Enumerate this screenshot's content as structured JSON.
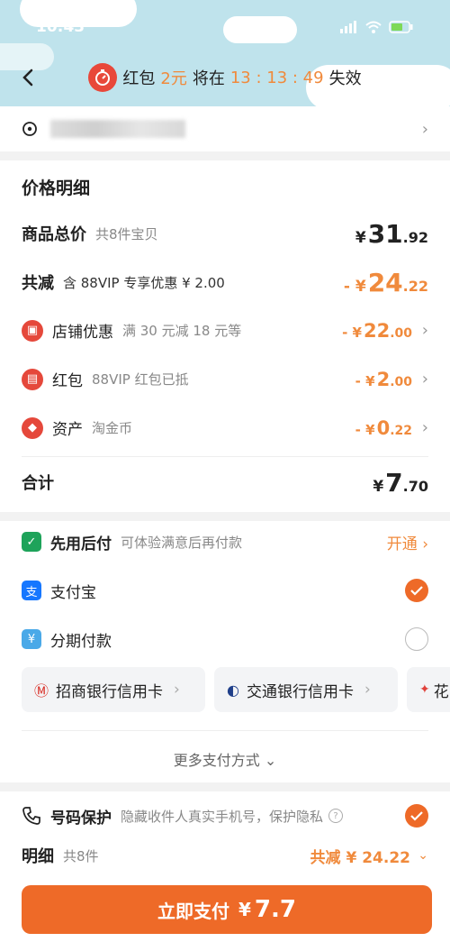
{
  "status_bar": {
    "time": "10:43"
  },
  "header": {
    "back_icon": "chevron-left-icon",
    "redpacket_label": "红包",
    "redpacket_amount": "2元",
    "expire_prefix": "将在",
    "countdown": "13 : 13 : 49",
    "expire_suffix": "失效"
  },
  "address": {
    "icon": "location-pin-icon"
  },
  "price_detail": {
    "heading": "价格明细",
    "total_label": "商品总价",
    "total_note": "共8件宝贝",
    "total_yen": "¥",
    "total_int": "31",
    "total_dec": ".92",
    "reduce_label": "共减",
    "reduce_note": "含 88VIP 专享优惠 ¥ 2.00",
    "reduce_prefix": "- ¥",
    "reduce_int": "24",
    "reduce_dec": ".22",
    "items": [
      {
        "icon": "shop-icon",
        "label": "店铺优惠",
        "note": "满 30 元减 18 元等",
        "prefix": "- ¥",
        "int": "22",
        "dec": ".00"
      },
      {
        "icon": "red-packet-icon",
        "label": "红包",
        "note": "88VIP 红包已抵",
        "prefix": "- ¥",
        "int": "2",
        "dec": ".00"
      },
      {
        "icon": "coin-tag-icon",
        "label": "资产",
        "note": "淘金币",
        "prefix": "- ¥",
        "int": "0",
        "dec": ".22"
      }
    ],
    "sum_label": "合计",
    "sum_yen": "¥",
    "sum_int": "7",
    "sum_dec": ".70"
  },
  "payment": {
    "later_label": "先用后付",
    "later_note": "可体验满意后再付款",
    "later_action": "开通 ›",
    "alipay_label": "支付宝",
    "installment_label": "分期付款",
    "banks": [
      "招商银行信用卡",
      "交通银行信用卡",
      "花"
    ],
    "more": "更多支付方式 ⌄"
  },
  "bottom": {
    "protect_label": "号码保护",
    "protect_note": "隐藏收件人真实手机号，保护隐私",
    "detail_label": "明细",
    "detail_count": "共8件",
    "detail_reduce": "共减 ¥ 24.22",
    "pay_label": "立即支付",
    "pay_yen": "¥",
    "pay_amount": "7.7"
  },
  "colors": {
    "accent": "#ee6a28",
    "red": "#e5483b",
    "alipay": "#1677ff",
    "sky": "#bfe3ec"
  }
}
